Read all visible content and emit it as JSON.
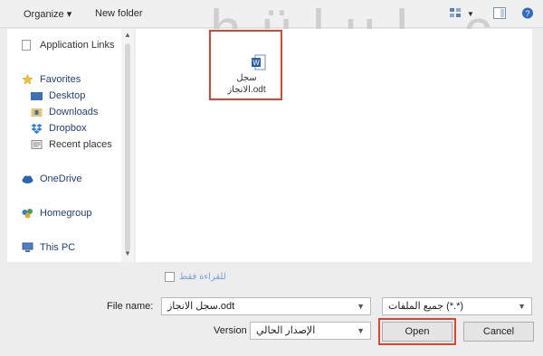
{
  "toolbar": {
    "organize": "Organize ▾",
    "new_folder": "New folder"
  },
  "watermark": "hülul.c",
  "nav": {
    "items": [
      {
        "label": "Application Links"
      },
      {
        "label": "Favorites"
      },
      {
        "label": "Desktop"
      },
      {
        "label": "Downloads"
      },
      {
        "label": "Dropbox"
      },
      {
        "label": "Recent places"
      },
      {
        "label": "OneDrive"
      },
      {
        "label": "Homegroup"
      },
      {
        "label": "This PC"
      }
    ]
  },
  "file": {
    "name_line1": "سجل",
    "name_line2": "الانجاز.odt"
  },
  "readonly_label": "للقراءة فقط",
  "file_name": {
    "label": "File name:",
    "value": "سجل الانجاز.odt"
  },
  "file_type": {
    "value": "جميع الملفات (*.*)"
  },
  "version": {
    "label": "Version",
    "value": "الإصدار الحالي"
  },
  "buttons": {
    "open": "Open",
    "cancel": "Cancel"
  },
  "colors": {
    "highlight": "#e0442f",
    "nav_text": "#1f3f80"
  }
}
